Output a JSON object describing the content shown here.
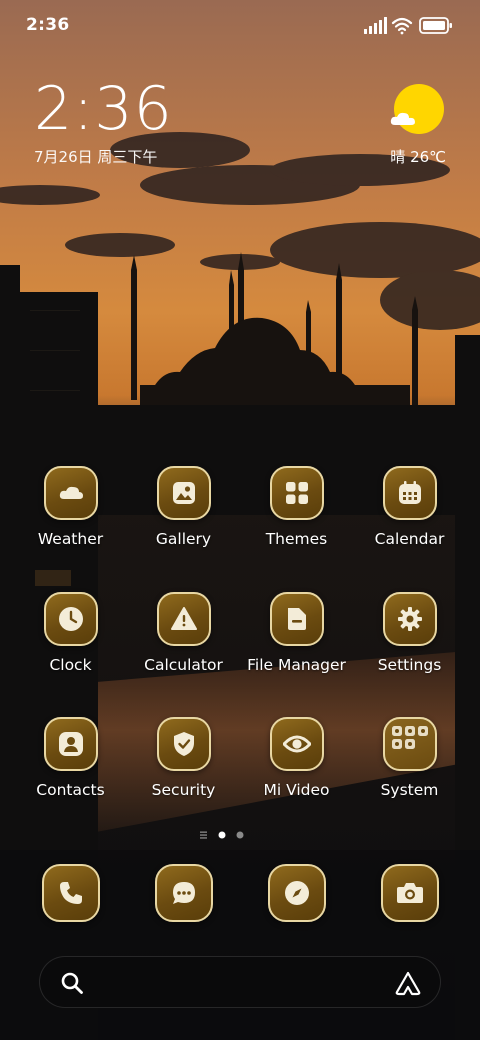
{
  "status_bar": {
    "time": "2:36"
  },
  "clock_widget": {
    "time": "2:36",
    "date": "7月26日 周三下午"
  },
  "weather_widget": {
    "text": "晴 26℃",
    "icon": "sunny-cloud-icon"
  },
  "apps": [
    {
      "label": "Weather",
      "icon": "weather-icon"
    },
    {
      "label": "Gallery",
      "icon": "gallery-icon"
    },
    {
      "label": "Themes",
      "icon": "themes-icon"
    },
    {
      "label": "Calendar",
      "icon": "calendar-icon"
    },
    {
      "label": "Clock",
      "icon": "clock-icon"
    },
    {
      "label": "Calculator",
      "icon": "calculator-icon"
    },
    {
      "label": "File Manager",
      "icon": "file-manager-icon"
    },
    {
      "label": "Settings",
      "icon": "settings-icon"
    },
    {
      "label": "Contacts",
      "icon": "contacts-icon"
    },
    {
      "label": "Security",
      "icon": "security-icon"
    },
    {
      "label": "Mi Video",
      "icon": "mi-video-icon"
    },
    {
      "label": "System",
      "icon": "system-folder-icon"
    }
  ],
  "dock": [
    {
      "icon": "phone-icon"
    },
    {
      "icon": "messages-icon"
    },
    {
      "icon": "browser-icon"
    },
    {
      "icon": "camera-icon"
    }
  ],
  "page_indicator": {
    "pages": 2,
    "current": 1
  },
  "search": {
    "placeholder": ""
  },
  "colors": {
    "icon_gold": "#7a5614",
    "icon_border": "#e8d7a3",
    "weather_sun": "#ffd600"
  }
}
